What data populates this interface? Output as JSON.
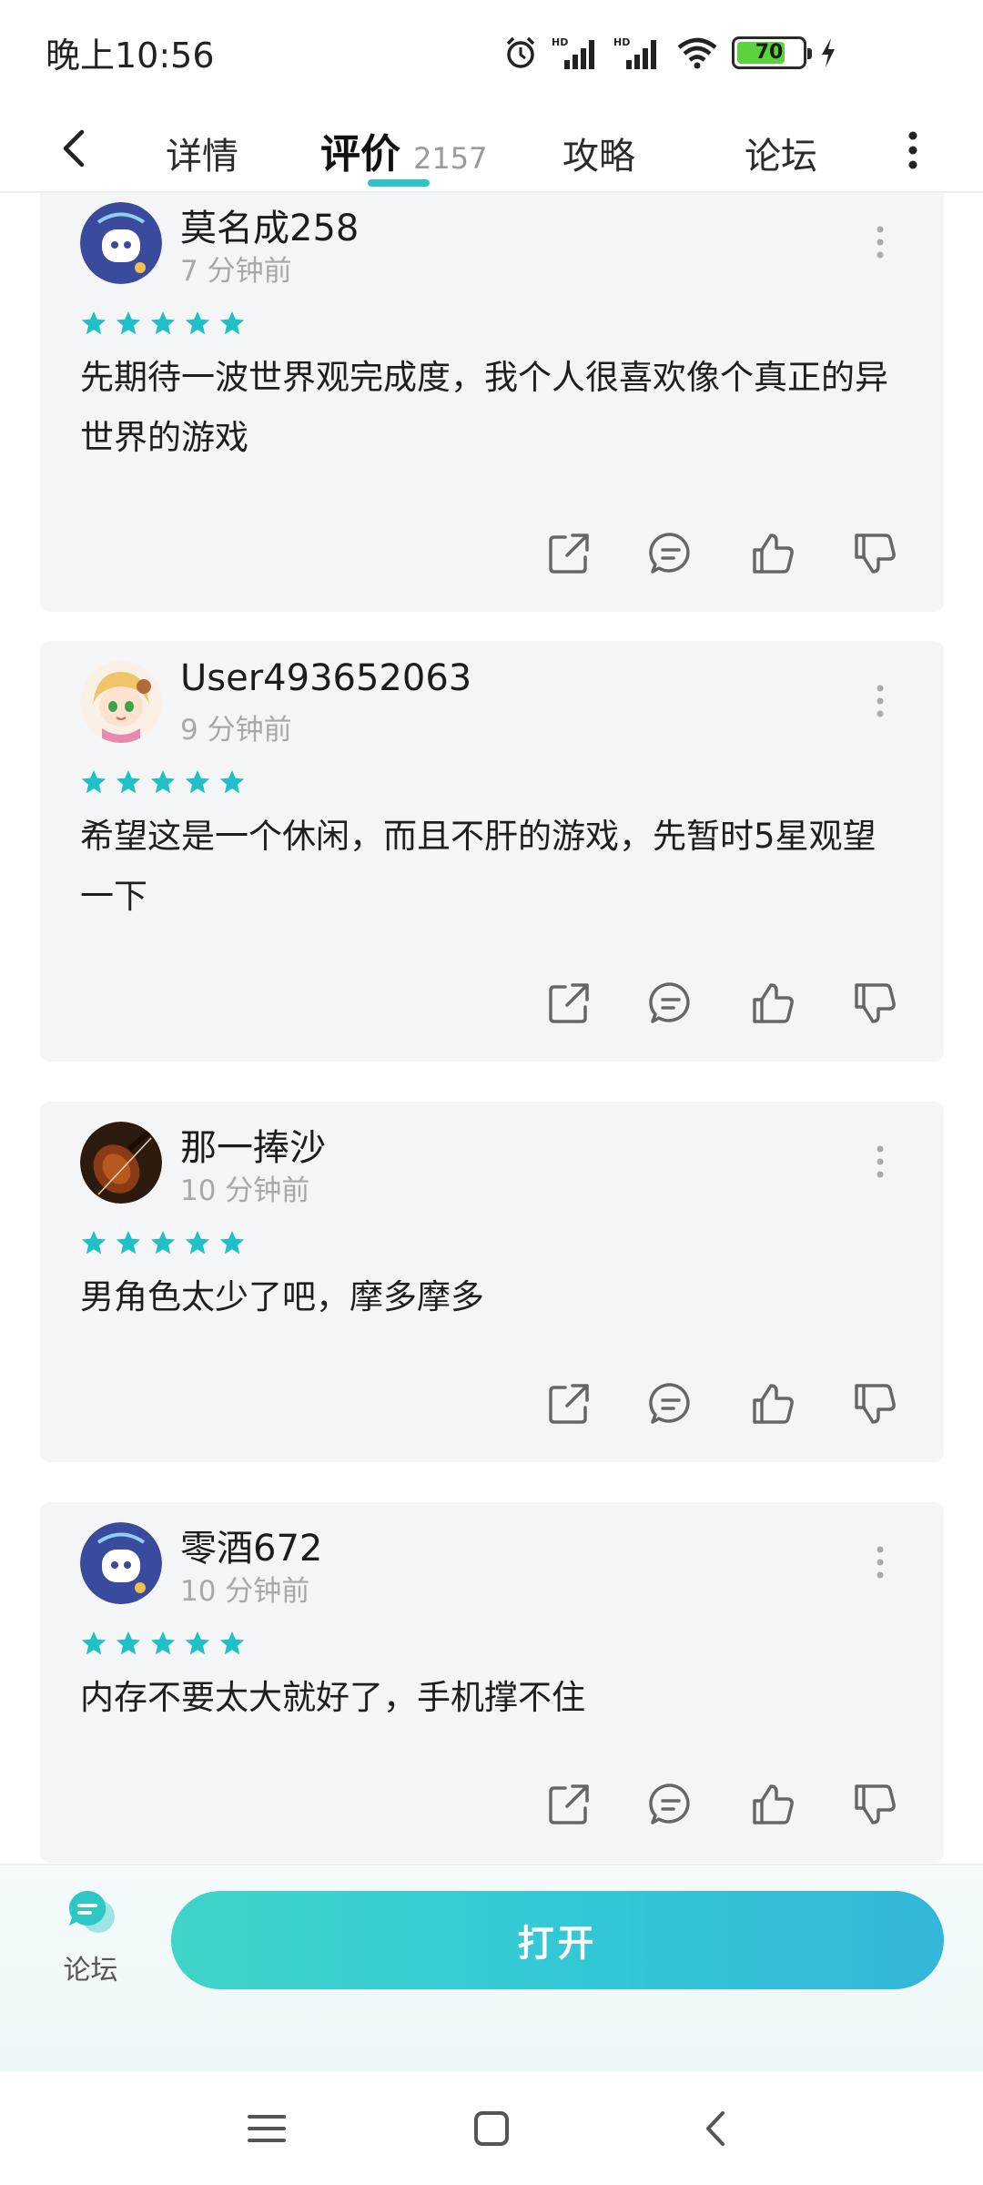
{
  "status": {
    "time": "晚上10:56",
    "battery": "70"
  },
  "nav": {
    "tabs": [
      {
        "label": "详情"
      },
      {
        "label": "评价",
        "count": "2157"
      },
      {
        "label": "攻略"
      },
      {
        "label": "论坛"
      }
    ]
  },
  "reviews": [
    {
      "user": "莫名成258",
      "time": "7 分钟前",
      "stars": 5,
      "text": "先期待一波世界观完成度，我个人很喜欢像个真正的异世界的游戏"
    },
    {
      "user": "User493652063",
      "time": "9 分钟前",
      "stars": 5,
      "text": "希望这是一个休闲，而且不肝的游戏，先暂时5星观望一下"
    },
    {
      "user": "那一捧沙",
      "time": "10 分钟前",
      "stars": 5,
      "text": "男角色太少了吧，摩多摩多"
    },
    {
      "user": "零酒672",
      "time": "10 分钟前",
      "stars": 5,
      "text": "内存不要太大就好了，手机撑不住"
    }
  ],
  "bottom": {
    "forum_label": "论坛",
    "open_label": "打开"
  },
  "colors": {
    "accent": "#2dc4c4",
    "star": "#20c0c8",
    "card_bg": "#f4f5f7"
  }
}
